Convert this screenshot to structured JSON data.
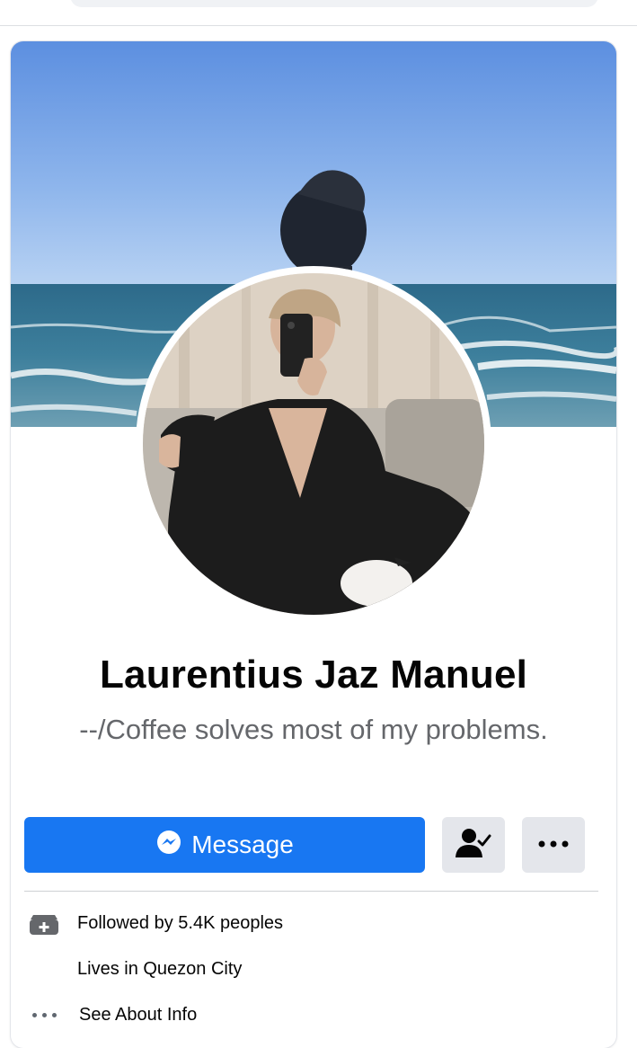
{
  "profile": {
    "name": "Laurentius Jaz Manuel",
    "bio": "--/Coffee solves most of my problems."
  },
  "actions": {
    "message_label": "Message",
    "message_icon": "messenger-icon",
    "friend_icon": "friends-check-icon",
    "more_icon": "more-dots-icon"
  },
  "intro": {
    "followers": "Followed by 5.4K peoples",
    "lives": "Lives in Quezon City",
    "about": "See About Info"
  },
  "colors": {
    "primary": "#1877f2",
    "secondary_button": "#e4e6eb",
    "muted_text": "#65676b"
  }
}
